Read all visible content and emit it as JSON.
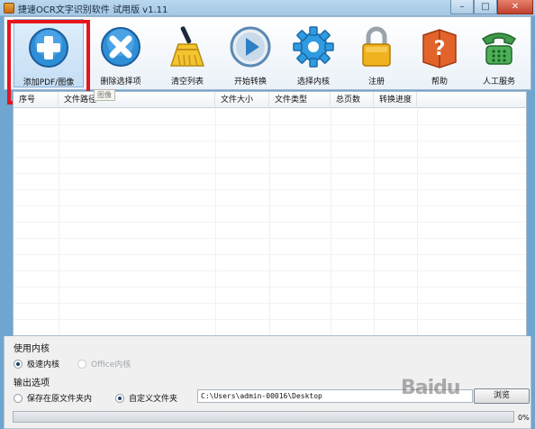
{
  "window": {
    "title": "捷速OCR文字识别软件 试用版 v1.11",
    "controls": [
      "–",
      "□",
      "✕"
    ]
  },
  "toolbar": {
    "items": [
      {
        "label": "添加PDF/图像",
        "icon": "add-plus-icon",
        "selected": true
      },
      {
        "label": "删除选择项",
        "icon": "delete-x-icon"
      },
      {
        "label": "清空列表",
        "icon": "broom-icon"
      },
      {
        "label": "开始转换",
        "icon": "play-icon"
      },
      {
        "label": "选择内核",
        "icon": "gear-icon"
      },
      {
        "label": "注册",
        "icon": "lock-icon"
      },
      {
        "label": "帮助",
        "icon": "help-book-icon"
      },
      {
        "label": "人工服务",
        "icon": "phone-icon"
      }
    ],
    "tooltip": "图像"
  },
  "table": {
    "columns": [
      "序号",
      "文件路径",
      "文件大小",
      "文件类型",
      "总页数",
      "转换进度"
    ],
    "rows": []
  },
  "engine": {
    "title": "使用内核",
    "options": [
      {
        "label": "极速内核",
        "selected": true,
        "enabled": true
      },
      {
        "label": "Office内核",
        "selected": false,
        "enabled": false
      }
    ]
  },
  "output": {
    "title": "输出选项",
    "options": [
      {
        "label": "保存在原文件夹内",
        "selected": false
      },
      {
        "label": "自定义文件夹",
        "selected": true
      }
    ],
    "path": "C:\\Users\\admin-00016\\Desktop",
    "browse_label": "浏览"
  },
  "progress": {
    "value": 0,
    "label": "0%"
  },
  "watermark": "Baidu",
  "colors": {
    "highlight": "#e8141b",
    "accent": "#2f8fd6",
    "progress": "#3fb34f"
  }
}
